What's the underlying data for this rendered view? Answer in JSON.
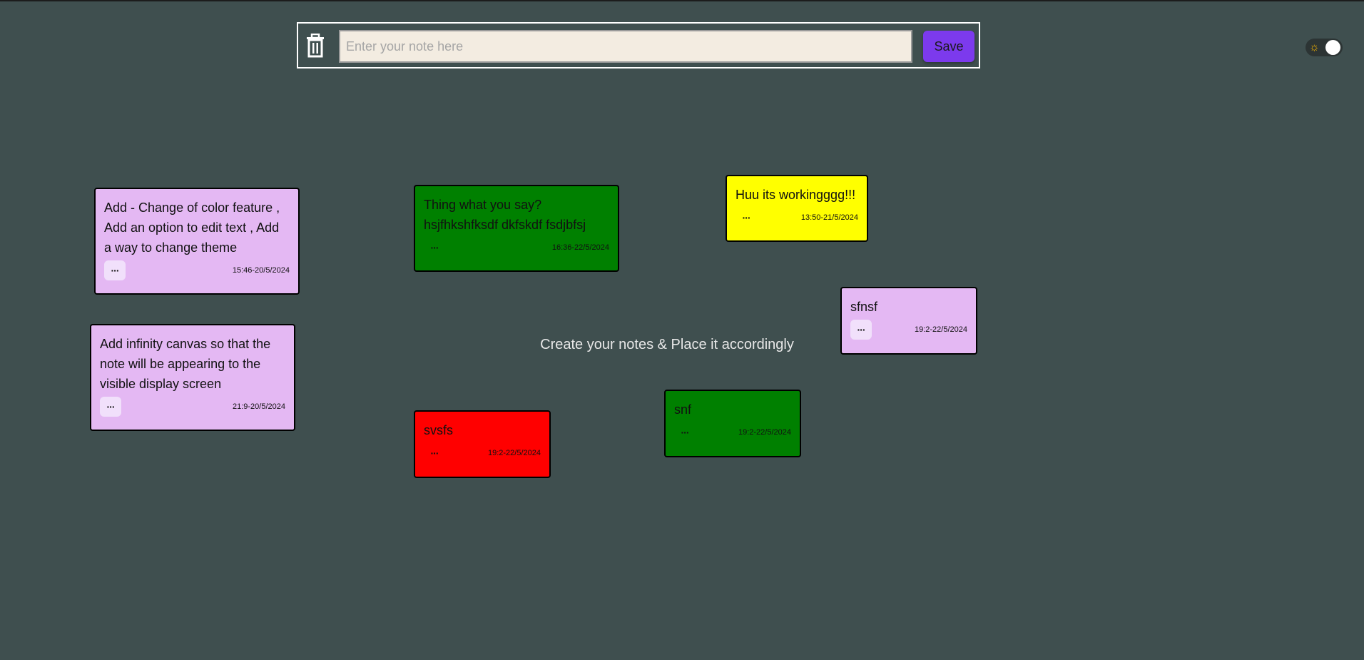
{
  "toolbar": {
    "input_placeholder": "Enter your note here",
    "input_value": "",
    "save_label": "Save",
    "trash_icon": "trash-icon"
  },
  "theme": {
    "mode": "dark",
    "icon": "sun-icon"
  },
  "canvas": {
    "hint": "Create your notes & Place it accordingly",
    "background": "#3f4f4f"
  },
  "notes": [
    {
      "text": "Add - Change of color feature , Add an option to edit text , Add a way to change theme",
      "time": "15:46-20/5/2024",
      "menu": "···",
      "color": "#e4b8f3"
    },
    {
      "text": "Add infinity canvas so that the note will be appearing to the visible display screen",
      "time": "21:9-20/5/2024",
      "menu": "···",
      "color": "#e4b8f3"
    },
    {
      "text": "Thing what you say? hsjfhkshfksdf dkfskdf fsdjbfsj",
      "time": "16:36-22/5/2024",
      "menu": "···",
      "color": "#008000"
    },
    {
      "text": "svsfs",
      "time": "19:2-22/5/2024",
      "menu": "···",
      "color": "#ff0000"
    },
    {
      "text": "Huu its workingggg!!!",
      "time": "13:50-21/5/2024",
      "menu": "···",
      "color": "#ffff00"
    },
    {
      "text": "sfnsf",
      "time": "19:2-22/5/2024",
      "menu": "···",
      "color": "#e4b8f3"
    },
    {
      "text": "snf",
      "time": "19:2-22/5/2024",
      "menu": "···",
      "color": "#008000"
    }
  ],
  "colors": {
    "accent": "#7c3aed",
    "input_bg": "#f3ece1"
  }
}
